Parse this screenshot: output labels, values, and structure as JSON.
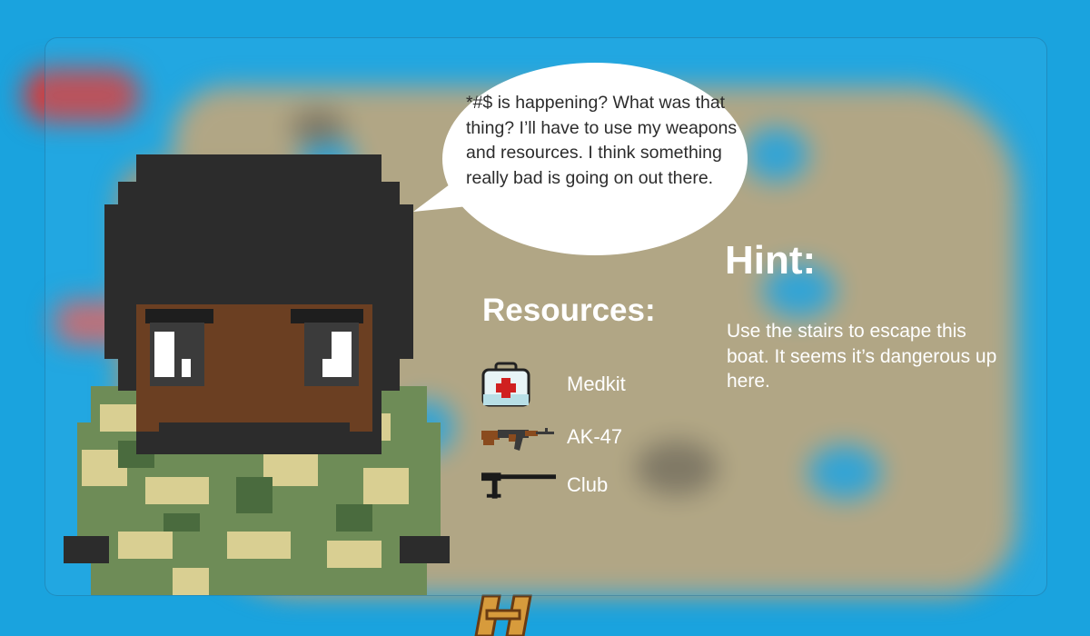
{
  "dialogue": {
    "speech": "*#$ is happening? What was that thing? I’ll have to use my weapons and resources. I think something really bad is going on out there."
  },
  "resources": {
    "title": "Resources:",
    "items": [
      {
        "label": "Medkit",
        "icon": "medkit-icon"
      },
      {
        "label": "AK-47",
        "icon": "rifle-icon"
      },
      {
        "label": "Club",
        "icon": "club-icon"
      }
    ]
  },
  "hint": {
    "title": "Hint:",
    "text": "Use the stairs to escape this boat. It seems it’s dangerous up here."
  },
  "colors": {
    "sea": "#1aa3de",
    "sand": "#c9a26e",
    "skin": "#6b3f22",
    "helmet": "#2c2c2c",
    "camo_green": "#6e8c57",
    "camo_tan": "#d9cf92"
  }
}
